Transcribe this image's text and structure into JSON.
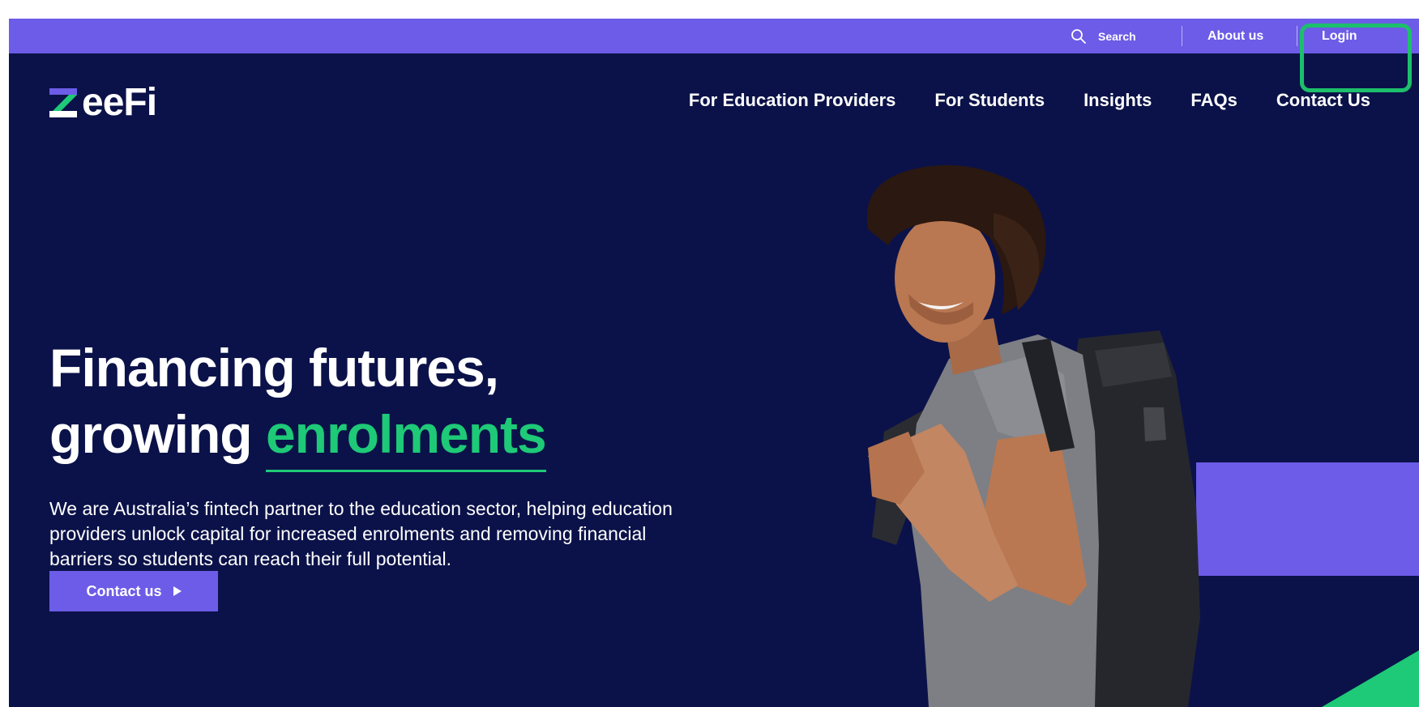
{
  "utility_bar": {
    "search_label": "Search",
    "about_label": "About us",
    "login_label": "Login"
  },
  "logo": {
    "text": "eeFi",
    "icon": "zeefi-z-logo"
  },
  "main_nav": {
    "items": [
      {
        "label": "For Education Providers"
      },
      {
        "label": "For Students"
      },
      {
        "label": "Insights"
      },
      {
        "label": "FAQs"
      },
      {
        "label": "Contact Us"
      }
    ]
  },
  "hero": {
    "title_line1": "Financing futures,",
    "title_line2_prefix": "growing ",
    "title_accent": "enrolments",
    "description": "We are Australia’s fintech partner to the education sector, helping education providers unlock capital for increased enrolments and removing financial barriers so students can reach their full potential.",
    "cta_label": "Contact us"
  },
  "colors": {
    "navy": "#0b1249",
    "purple": "#6c5ce7",
    "green": "#1ec977",
    "highlight": "#1cbf6b"
  },
  "icons": {
    "search": "search-icon",
    "cta": "play-arrow-icon"
  }
}
